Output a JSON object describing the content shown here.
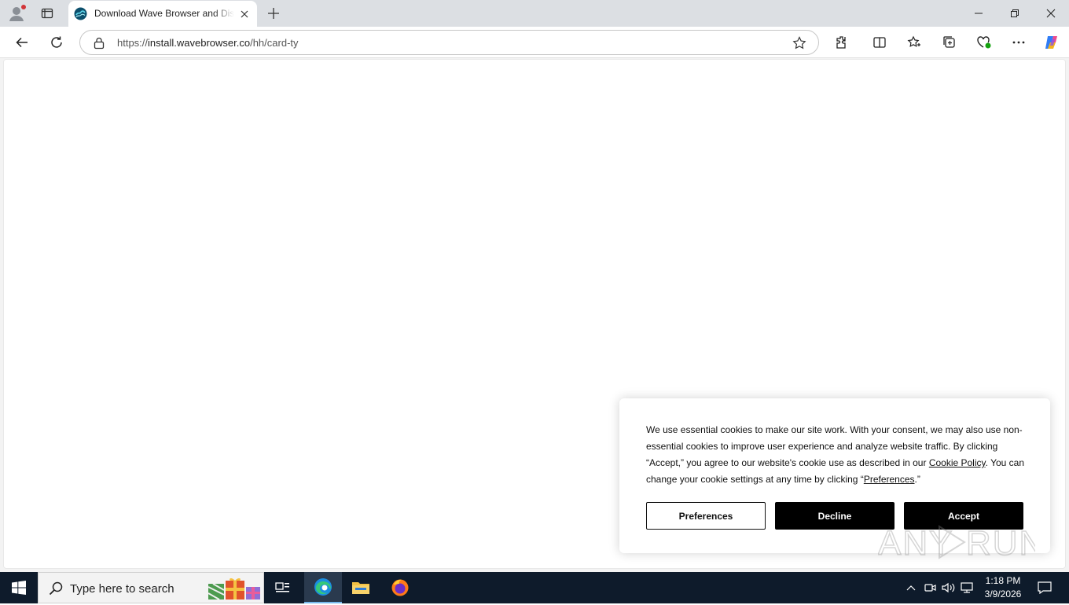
{
  "browser": {
    "tab": {
      "title": "Download Wave Browser and Discover a better way to browse"
    },
    "address_bar": {
      "url_prefix": "https://",
      "url_host": "install.wavebrowser.co",
      "url_path": "/hh/card-ty"
    }
  },
  "cookie_banner": {
    "text_part1": "We use essential cookies to make our site work. With your consent, we may also use non-essential cookies to improve user experience and analyze website traffic. By clicking “Accept,” you agree to our website's cookie use as described in our ",
    "cookie_policy_link": "Cookie Policy",
    "text_part2": ". You can change your cookie settings at any time by clicking “",
    "preferences_link": "Preferences",
    "text_part3": ".”",
    "buttons": {
      "preferences": "Preferences",
      "decline": "Decline",
      "accept": "Accept"
    }
  },
  "watermark": {
    "text": "ANY RUN"
  },
  "taskbar": {
    "search_placeholder": "Type here to search",
    "clock": {
      "time": "1:18 PM",
      "date": "3/9/2026"
    }
  },
  "colors": {
    "taskbar_bg": "#0e1b2b",
    "accent": "#0078d4",
    "button_dark": "#000000"
  }
}
